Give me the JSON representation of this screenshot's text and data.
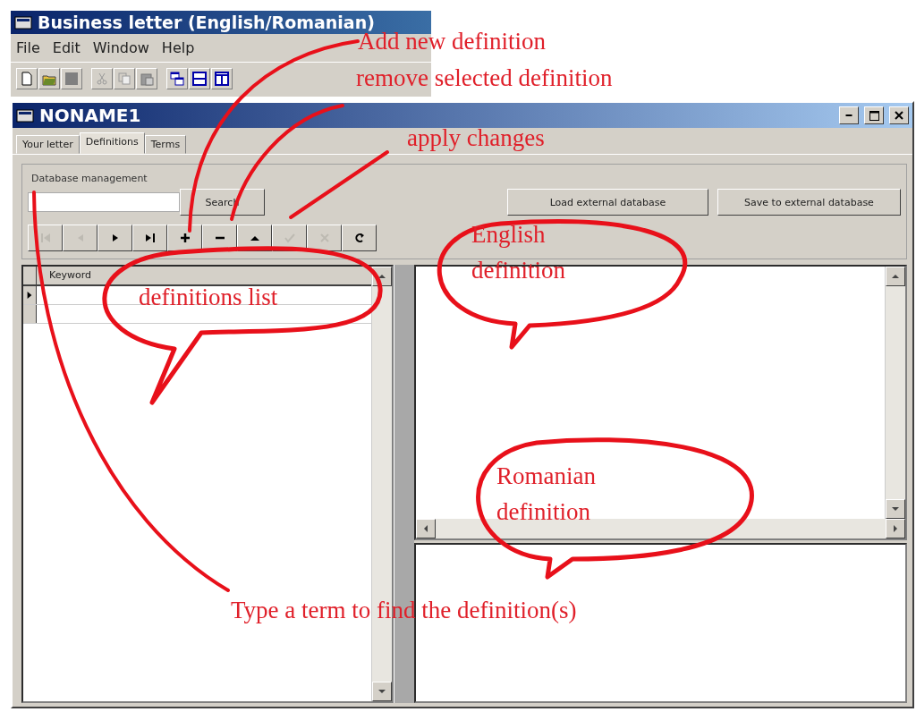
{
  "app": {
    "title": "Business letter (English/Romanian)",
    "menu": [
      "File",
      "Edit",
      "Window",
      "Help"
    ]
  },
  "document": {
    "title": "NONAME1",
    "tabs": [
      {
        "label": "Your letter",
        "selected": false
      },
      {
        "label": "Definitions",
        "selected": true
      },
      {
        "label": "Terms",
        "selected": false
      }
    ],
    "database": {
      "title": "Database management",
      "search_button": "Search",
      "buttons": [
        "Load external database",
        "Save to external database"
      ]
    },
    "navigator": [
      {
        "disabled": true
      },
      {
        "disabled": true
      },
      {
        "disabled": false
      },
      {
        "disabled": false
      },
      {
        "disabled": false
      },
      {
        "disabled": false
      },
      {
        "disabled": false
      },
      {
        "disabled": true
      },
      {
        "disabled": true
      },
      {
        "disabled": false
      }
    ],
    "grid": {
      "columns": [
        "Keyword"
      ],
      "rows": [
        {
          "selected": true
        },
        {
          "selected": false
        }
      ]
    }
  },
  "annotations": [
    {
      "kind": "note",
      "text": "Add new definition"
    },
    {
      "kind": "note",
      "text": "remove selected definition"
    },
    {
      "kind": "note",
      "text": "apply changes"
    },
    {
      "kind": "bubble",
      "text": "English definition"
    },
    {
      "kind": "bubble",
      "text": "definitions list"
    },
    {
      "kind": "bubble",
      "text": "Romanian definition"
    },
    {
      "kind": "note",
      "text": "Type a term to find the definition(s)"
    }
  ]
}
